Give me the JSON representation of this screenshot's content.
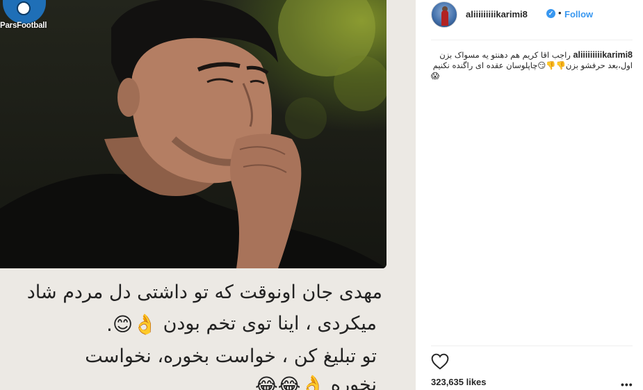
{
  "post": {
    "logo_text": "ParsFootball",
    "quote_line1": "مهدی جان اونوقت که تو داشتی دل مردم شاد",
    "quote_line2": "میکردی ، اینا توی تخم بودن",
    "quote_line2_emoji": "👌😊.",
    "quote_line3": "تو تبلیغ کن ، خواست بخوره، نخواست",
    "quote_line4": "نخوره",
    "quote_line4_emoji": "👌😂😂"
  },
  "header": {
    "username": "aliiiiiiiiikarimi8",
    "verified_mark": "✓",
    "separator": "•",
    "follow_label": "Follow"
  },
  "caption": {
    "username": "aliiiiiiiiikarimi8",
    "text": "راجب اقا کریم هم دهنتو یه مسواک بزن اول،بعد حرفشو بزن👎👎😏چاپلوسان عقده ای راگنده نکنیم",
    "end_emoji": "😱"
  },
  "footer": {
    "likes": "323,635 likes",
    "more_label": "•••"
  },
  "colors": {
    "link_blue": "#3897f0",
    "text_dark": "#262626",
    "divider": "#efefef"
  },
  "icons": {
    "like": "heart-outline-icon",
    "verified": "verified-badge-icon",
    "more": "ellipsis-icon"
  }
}
